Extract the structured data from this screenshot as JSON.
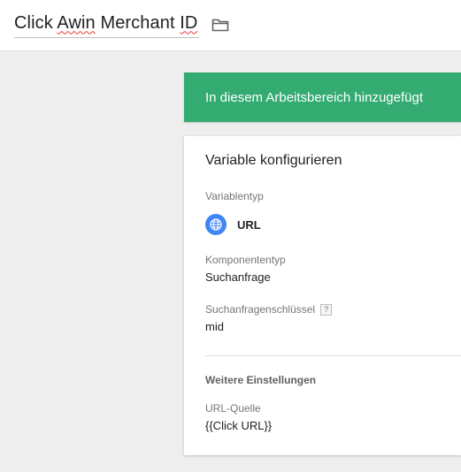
{
  "header": {
    "title_part1": "Click ",
    "title_part2": "Awin",
    "title_part3": " Merchant ",
    "title_part4": "ID",
    "folder_icon": "folder-icon"
  },
  "banner": {
    "text": "In diesem Arbeitsbereich hinzugefügt",
    "color": "#33ab71"
  },
  "config": {
    "title": "Variable konfigurieren",
    "variable_type_label": "Variablentyp",
    "variable_type_value": "URL",
    "variable_type_icon": "globe-icon",
    "component_type_label": "Komponententyp",
    "component_type_value": "Suchanfrage",
    "query_key_label": "Suchanfragenschlüssel",
    "help_glyph": "?",
    "query_key_value": "mid",
    "more_settings_heading": "Weitere Einstellungen",
    "url_source_label": "URL-Quelle",
    "url_source_value": "{{Click URL}}"
  }
}
